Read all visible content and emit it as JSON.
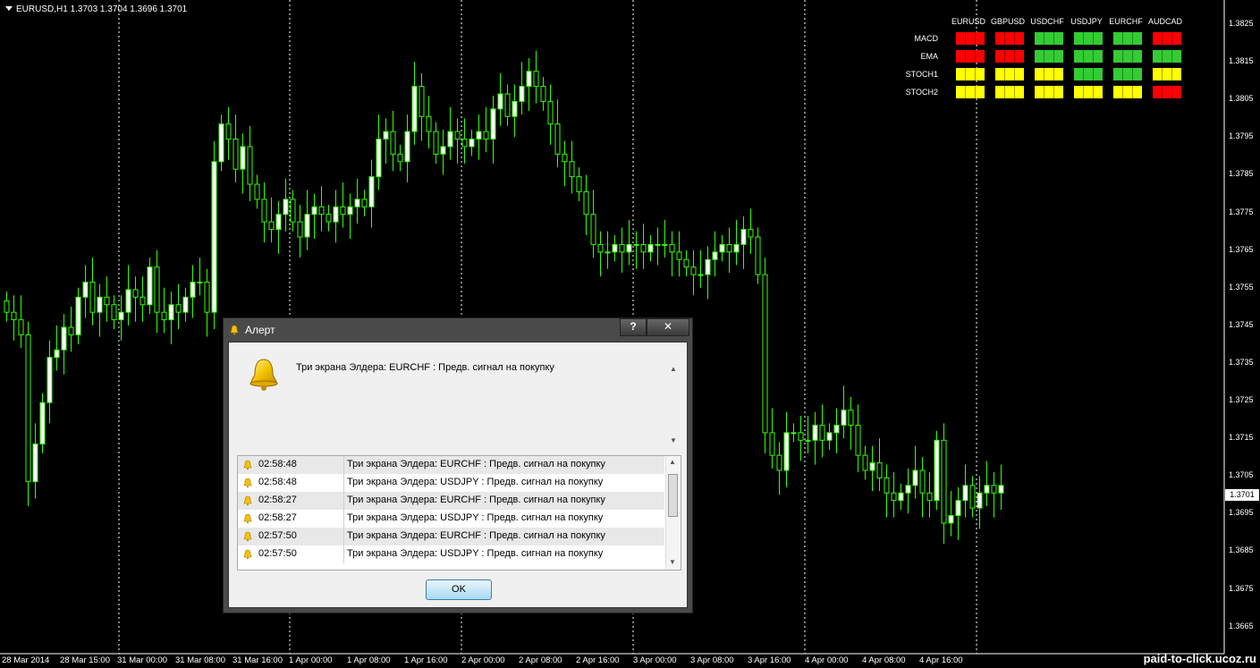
{
  "symbol": "EURUSD,H1  1.3703 1.3704 1.3696 1.3701",
  "current_price": "1.3701",
  "y_ticks": [
    "1.3825",
    "1.3815",
    "1.3805",
    "1.3795",
    "1.3785",
    "1.3775",
    "1.3765",
    "1.3755",
    "1.3745",
    "1.3735",
    "1.3725",
    "1.3715",
    "1.3705",
    "1.3695",
    "1.3685",
    "1.3675",
    "1.3665"
  ],
  "x_ticks": [
    "28 Mar 2014",
    "28 Mar 15:00",
    "31 Mar 00:00",
    "31 Mar 08:00",
    "31 Mar 16:00",
    "1 Apr 00:00",
    "1 Apr 08:00",
    "1 Apr 16:00",
    "2 Apr 00:00",
    "2 Apr 08:00",
    "2 Apr 16:00",
    "3 Apr 00:00",
    "3 Apr 08:00",
    "3 Apr 16:00",
    "4 Apr 00:00",
    "4 Apr 08:00",
    "4 Apr 16:00"
  ],
  "watermark": "paid-to-click.ucoz.ru",
  "matrix": {
    "columns": [
      "EURUSD",
      "GBPUSD",
      "USDCHF",
      "USDJPY",
      "EURCHF",
      "AUDCAD"
    ],
    "rows": [
      {
        "label": "MACD",
        "states": [
          "red",
          "red",
          "green",
          "green",
          "green",
          "red"
        ]
      },
      {
        "label": "EMA",
        "states": [
          "red",
          "red",
          "green",
          "green",
          "green",
          "green"
        ]
      },
      {
        "label": "STOCH1",
        "states": [
          "yellow",
          "yellow",
          "yellow",
          "green",
          "green",
          "yellow"
        ]
      },
      {
        "label": "STOCH2",
        "states": [
          "yellow",
          "yellow",
          "yellow",
          "yellow",
          "yellow",
          "red"
        ]
      }
    ],
    "colors": {
      "red": "#ff0000",
      "green": "#33cc33",
      "yellow": "#ffff00"
    }
  },
  "dialog": {
    "title": "Алерт",
    "help_label": "?",
    "close_label": "✕",
    "message": "Три экрана Элдера: EURCHF : Предв. сигнал на покупку",
    "log": [
      {
        "time": "02:58:48",
        "text": "Три экрана Элдера: EURCHF : Предв. сигнал на покупку"
      },
      {
        "time": "02:58:48",
        "text": "Три экрана Элдера: USDJPY : Предв. сигнал на покупку"
      },
      {
        "time": "02:58:27",
        "text": "Три экрана Элдера: EURCHF : Предв. сигнал на покупку"
      },
      {
        "time": "02:58:27",
        "text": "Три экрана Элдера: USDJPY : Предв. сигнал на покупку"
      },
      {
        "time": "02:57:50",
        "text": "Три экрана Элдера: EURCHF : Предв. сигнал на покупку"
      },
      {
        "time": "02:57:50",
        "text": "Три экрана Элдера: USDJPY : Предв. сигнал на покупку"
      }
    ],
    "ok_label": "OK"
  },
  "colors": {
    "bull": "#ffffff",
    "bear": "#000000",
    "wick": "#33ff00",
    "grid": "#ffffff"
  }
}
